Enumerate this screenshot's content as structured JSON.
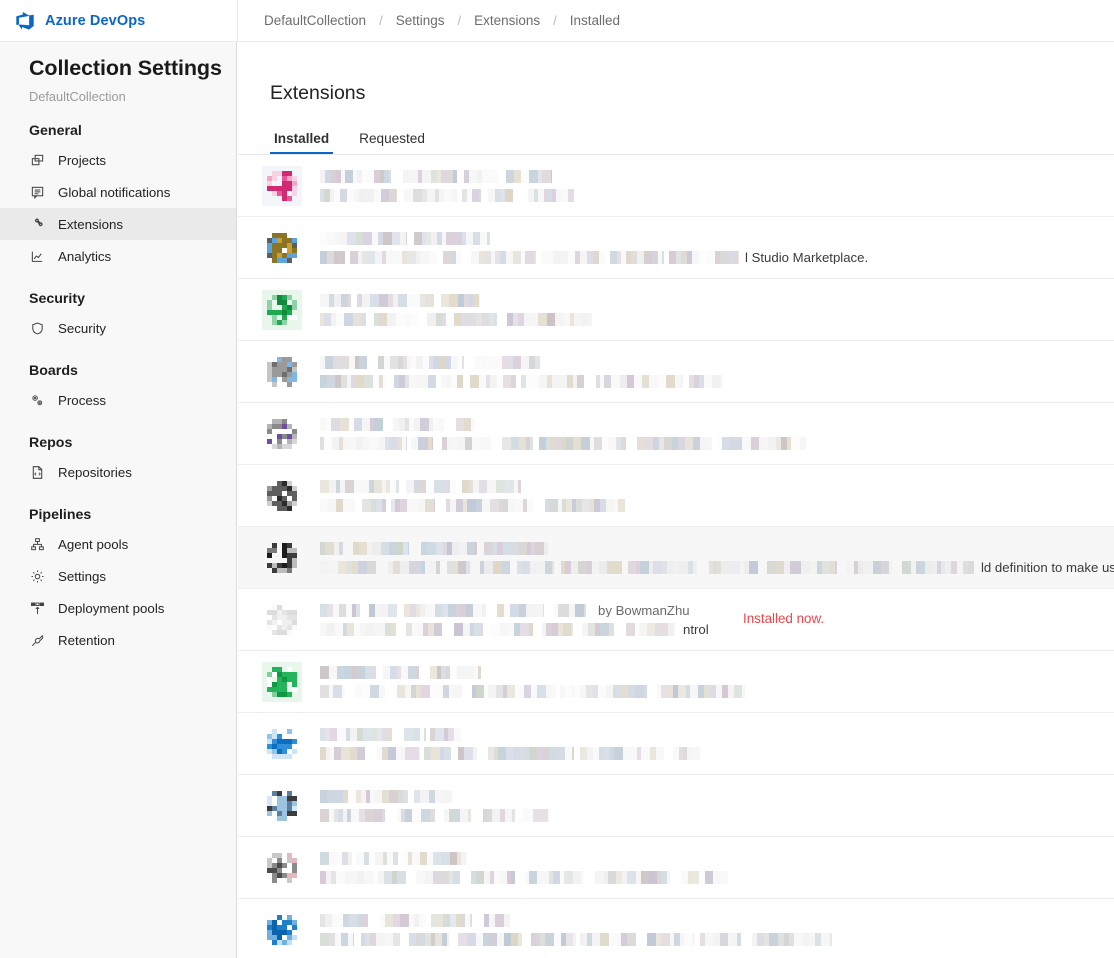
{
  "topbar": {
    "brand": "Azure DevOps",
    "logo_icon": "azure-devops-logo-icon",
    "brand_color": "#0a67c8",
    "breadcrumb": [
      "DefaultCollection",
      "Settings",
      "Extensions",
      "Installed"
    ],
    "breadcrumb_separator": "/"
  },
  "sidebar": {
    "title": "Collection Settings",
    "subtitle": "DefaultCollection",
    "groups": [
      {
        "label": "General",
        "items": [
          {
            "label": "Projects",
            "icon": "projects-icon",
            "selected": false
          },
          {
            "label": "Global notifications",
            "icon": "notification-bubble-icon",
            "selected": false
          },
          {
            "label": "Extensions",
            "icon": "puzzle-piece-icon",
            "selected": true
          },
          {
            "label": "Analytics",
            "icon": "analytics-chart-icon",
            "selected": false
          }
        ]
      },
      {
        "label": "Security",
        "items": [
          {
            "label": "Security",
            "icon": "shield-icon",
            "selected": false
          }
        ]
      },
      {
        "label": "Boards",
        "items": [
          {
            "label": "Process",
            "icon": "process-gears-icon",
            "selected": false
          }
        ]
      },
      {
        "label": "Repos",
        "items": [
          {
            "label": "Repositories",
            "icon": "code-file-icon",
            "selected": false
          }
        ]
      },
      {
        "label": "Pipelines",
        "items": [
          {
            "label": "Agent pools",
            "icon": "agent-pools-hierarchy-icon",
            "selected": false
          },
          {
            "label": "Settings",
            "icon": "gear-icon",
            "selected": false
          },
          {
            "label": "Deployment pools",
            "icon": "deployment-pools-icon",
            "selected": false
          },
          {
            "label": "Retention",
            "icon": "retention-pin-icon",
            "selected": false
          }
        ]
      }
    ]
  },
  "main": {
    "page_title": "Extensions",
    "tabs": [
      {
        "label": "Installed",
        "active": true
      },
      {
        "label": "Requested",
        "active": false
      }
    ],
    "accent_color": "#0a67c8",
    "status_color": "#e8474c",
    "extensions": [
      {
        "icon_name": "extension-icon-pink",
        "icon_colors": [
          "#f2f6fb",
          "#e8579a",
          "#d12a72",
          "#f3a7c8",
          "#f7d3e4"
        ],
        "title_redacted": true,
        "subtitle_redacted": true,
        "title_visible_suffix": "",
        "subtitle_visible_suffix": "",
        "status": "",
        "hovered": false
      },
      {
        "icon_name": "extension-icon-gold",
        "icon_colors": [
          "#ffffff",
          "#c8a02a",
          "#8a7425",
          "#5e5e5e",
          "#5ba3dd"
        ],
        "title_redacted": true,
        "subtitle_redacted": true,
        "title_visible_suffix": "",
        "subtitle_visible_suffix": "l Studio Marketplace.",
        "status": "",
        "hovered": false
      },
      {
        "icon_name": "extension-icon-green",
        "icon_colors": [
          "#e8f6ec",
          "#0f8a3c",
          "#1faa52",
          "#8fd2a8",
          "#ffffff"
        ],
        "title_redacted": true,
        "subtitle_redacted": true,
        "title_visible_suffix": "",
        "subtitle_visible_suffix": "",
        "status": "",
        "hovered": false
      },
      {
        "icon_name": "extension-icon-grayblue",
        "icon_colors": [
          "#ffffff",
          "#6e6e6e",
          "#9a9a9a",
          "#c6c6c6",
          "#7fb8e6"
        ],
        "title_redacted": true,
        "subtitle_redacted": true,
        "title_visible_suffix": "",
        "subtitle_visible_suffix": "",
        "status": "",
        "hovered": false
      },
      {
        "icon_name": "extension-icon-purple",
        "icon_colors": [
          "#ffffff",
          "#6d4f9e",
          "#8a8a8a",
          "#b5b5b5",
          "#d8d8d8"
        ],
        "title_redacted": true,
        "subtitle_redacted": true,
        "title_visible_suffix": "",
        "subtitle_visible_suffix": "",
        "status": "",
        "hovered": false
      },
      {
        "icon_name": "extension-icon-darkgray",
        "icon_colors": [
          "#ffffff",
          "#2b2b2b",
          "#5e5e5e",
          "#9a9a9a",
          "#cfcfcf"
        ],
        "title_redacted": true,
        "subtitle_redacted": true,
        "title_visible_suffix": "",
        "subtitle_visible_suffix": "",
        "status": "",
        "hovered": false
      },
      {
        "icon_name": "extension-icon-black",
        "icon_colors": [
          "#f7f7f7",
          "#1c1c1c",
          "#3c3c3c",
          "#7a7a7a",
          "#bdbdbd"
        ],
        "title_redacted": true,
        "subtitle_redacted": true,
        "title_visible_suffix": "",
        "subtitle_visible_suffix": "ld definition to make us",
        "status": "",
        "hovered": true
      },
      {
        "icon_name": "extension-icon-white",
        "icon_colors": [
          "#ffffff",
          "#f0f0f0",
          "#e4e4e4",
          "#dcdcdc",
          "#fafafa"
        ],
        "title_redacted": true,
        "subtitle_redacted": true,
        "title_visible_suffix": "by BowmanZhu",
        "subtitle_visible_suffix": "ntrol",
        "status": "Installed now.",
        "hovered": false
      },
      {
        "icon_name": "extension-icon-green-2",
        "icon_colors": [
          "#e8f6ec",
          "#0f9a42",
          "#25b35c",
          "#7fd09a",
          "#ffffff"
        ],
        "title_redacted": true,
        "subtitle_redacted": true,
        "title_visible_suffix": "",
        "subtitle_visible_suffix": "",
        "status": "",
        "hovered": false
      },
      {
        "icon_name": "extension-icon-blue",
        "icon_colors": [
          "#ffffff",
          "#0a6fc2",
          "#2f8fd8",
          "#8fc6ec",
          "#cfe4f7"
        ],
        "title_redacted": true,
        "subtitle_redacted": true,
        "title_visible_suffix": "",
        "subtitle_visible_suffix": "",
        "status": "",
        "hovered": false
      },
      {
        "icon_name": "extension-icon-lightblue",
        "icon_colors": [
          "#ffffff",
          "#5b7f9e",
          "#9cc4e0",
          "#d4e8f6",
          "#3c3c3c"
        ],
        "title_redacted": true,
        "subtitle_redacted": true,
        "title_visible_suffix": "",
        "subtitle_visible_suffix": "",
        "status": "",
        "hovered": false
      },
      {
        "icon_name": "extension-icon-graypink",
        "icon_colors": [
          "#ffffff",
          "#4a4a4a",
          "#8a8a8a",
          "#c9c9c9",
          "#e6b8bd"
        ],
        "title_redacted": true,
        "subtitle_redacted": true,
        "title_visible_suffix": "",
        "subtitle_visible_suffix": "",
        "status": "",
        "hovered": false
      },
      {
        "icon_name": "extension-icon-blue-2",
        "icon_colors": [
          "#ffffff",
          "#0c63ad",
          "#1f7fc8",
          "#6fb0e0",
          "#c4dff2"
        ],
        "title_redacted": true,
        "subtitle_redacted": true,
        "title_visible_suffix": "",
        "subtitle_visible_suffix": "",
        "status": "",
        "hovered": false
      }
    ]
  }
}
